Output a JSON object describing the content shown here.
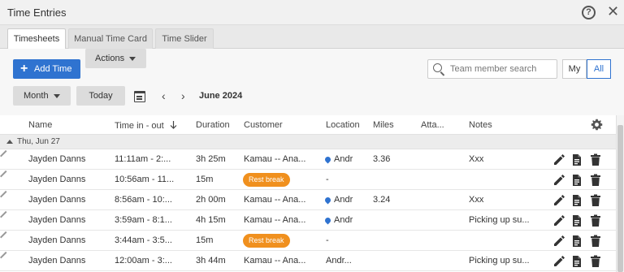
{
  "window": {
    "title": "Time Entries",
    "help_icon": "help-circle-icon",
    "close_icon": "close-icon",
    "help_glyph": "?",
    "close_glyph": "✕"
  },
  "tabs": [
    {
      "label": "Timesheets",
      "active": true
    },
    {
      "label": "Manual Time Card",
      "active": false
    },
    {
      "label": "Time Slider",
      "active": false
    }
  ],
  "toolbar": {
    "add_label": "Add Time",
    "add_glyph": "+",
    "actions_label": "Actions",
    "search_placeholder": "Team member search",
    "my_label": "My",
    "all_label": "All",
    "period_select": "Month",
    "today_label": "Today",
    "period_label": "June 2024",
    "prev_glyph": "‹",
    "next_glyph": "›"
  },
  "columns": {
    "name": "Name",
    "time": "Time in - out",
    "duration": "Duration",
    "customer": "Customer",
    "location": "Location",
    "miles": "Miles",
    "attachments": "Atta...",
    "notes": "Notes"
  },
  "group": {
    "label": "Thu, Jun 27"
  },
  "rows": [
    {
      "name": "Jayden Danns",
      "time": "11:11am - 2:...",
      "duration": "3h 25m",
      "customer": "Kamau -- Ana...",
      "location": "Andr",
      "location_pin": true,
      "miles": "3.36",
      "notes": "Xxx"
    },
    {
      "name": "Jayden Danns",
      "time": "10:56am - 11...",
      "duration": "15m",
      "customer": "Rest break",
      "customer_badge": true,
      "location": "-",
      "location_pin": false,
      "miles": "",
      "notes": ""
    },
    {
      "name": "Jayden Danns",
      "time": "8:56am - 10:...",
      "duration": "2h 00m",
      "customer": "Kamau -- Ana...",
      "location": "Andr",
      "location_pin": true,
      "miles": "3.24",
      "notes": "Xxx"
    },
    {
      "name": "Jayden Danns",
      "time": "3:59am - 8:1...",
      "duration": "4h 15m",
      "customer": "Kamau -- Ana...",
      "location": "Andr",
      "location_pin": true,
      "miles": "",
      "notes": "Picking up su..."
    },
    {
      "name": "Jayden Danns",
      "time": "3:44am - 3:5...",
      "duration": "15m",
      "customer": "Rest break",
      "customer_badge": true,
      "location": "-",
      "location_pin": false,
      "miles": "",
      "notes": ""
    },
    {
      "name": "Jayden Danns",
      "time": "12:00am - 3:...",
      "duration": "3h 44m",
      "customer": "Kamau -- Ana...",
      "location": "Andr...",
      "location_pin": false,
      "miles": "",
      "notes": "Picking up su..."
    }
  ],
  "colors": {
    "primary": "#2f73d0",
    "badge": "#f0901e",
    "link": "#2f73d0"
  }
}
